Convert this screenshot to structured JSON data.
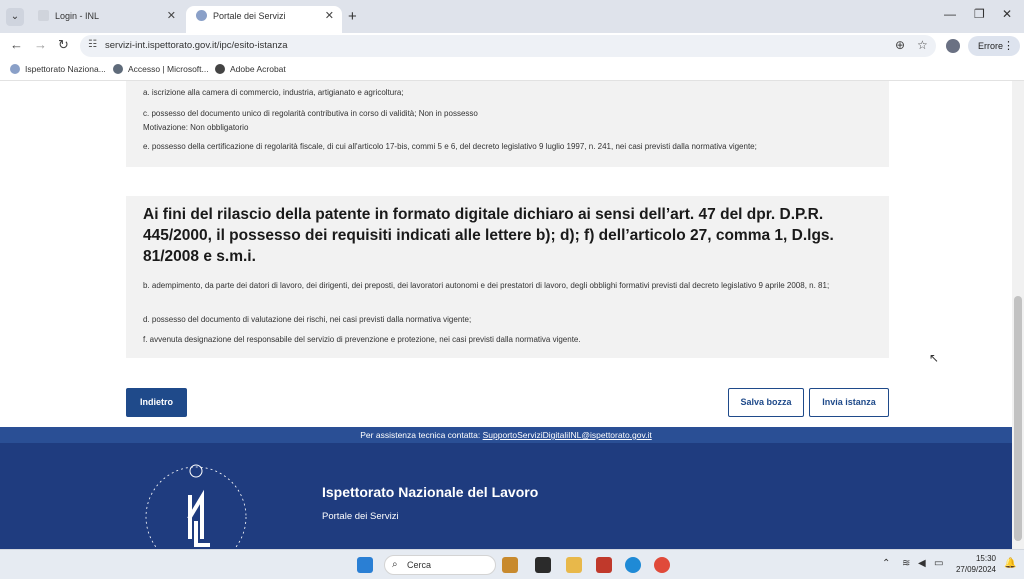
{
  "browser": {
    "tabs": [
      {
        "label": "Login - INL"
      },
      {
        "label": "Portale dei Servizi"
      }
    ],
    "url": "servizi-int.ispettorato.gov.it/ipc/esito-istanza",
    "profile_status": "Errore",
    "bookmarks": [
      {
        "label": "Ispettorato Naziona..."
      },
      {
        "label": "Accesso | Microsoft..."
      },
      {
        "label": "Adobe Acrobat"
      }
    ]
  },
  "section1": {
    "items": [
      "a. iscrizione alla camera di commercio, industria, artigianato e agricoltura;",
      "c. possesso del documento unico di regolarità contributiva in corso di validità; Non in possesso",
      "Motivazione: Non obbligatorio",
      "e. possesso della certificazione di regolarità fiscale, di cui all'articolo 17-bis, commi 5 e 6, del decreto legislativo 9 luglio 1997, n. 241, nei casi previsti dalla normativa vigente;"
    ]
  },
  "section2": {
    "heading": "Ai fini del rilascio della patente in formato digitale dichiaro ai sensi dell’art. 47 del dpr. D.P.R. 445/2000, il possesso dei requisiti indicati alle lettere b); d); f) dell’articolo 27, comma 1, D.lgs. 81/2008 e s.m.i.",
    "items": [
      "b. adempimento, da parte dei datori di lavoro, dei dirigenti, dei preposti, dei lavoratori autonomi e dei prestatori di lavoro, degli obblighi formativi previsti dal decreto legislativo 9 aprile 2008, n. 81;",
      "d. possesso del documento di valutazione dei rischi, nei casi previsti dalla normativa vigente;",
      "f. avvenuta designazione del responsabile del servizio di prevenzione e protezione, nei casi previsti dalla normativa vigente."
    ]
  },
  "actions": {
    "back_label": "Indietro",
    "save_label": "Salva bozza",
    "send_label": "Invia istanza"
  },
  "footer": {
    "support_text": "Per assistenza tecnica contatta: ",
    "support_email": "SupportoServiziDigitaliINL@ispettorato.gov.it",
    "org_name": "Ispettorato Nazionale del Lavoro",
    "org_subtitle": "Portale dei Servizi"
  },
  "taskbar": {
    "search_placeholder": "Cerca",
    "time": "15:30",
    "date": "27/09/2024"
  },
  "colors": {
    "primary": "#1f4a8a",
    "footer_bg": "#1f3c7f",
    "panel_bg": "#f2f2f2"
  }
}
